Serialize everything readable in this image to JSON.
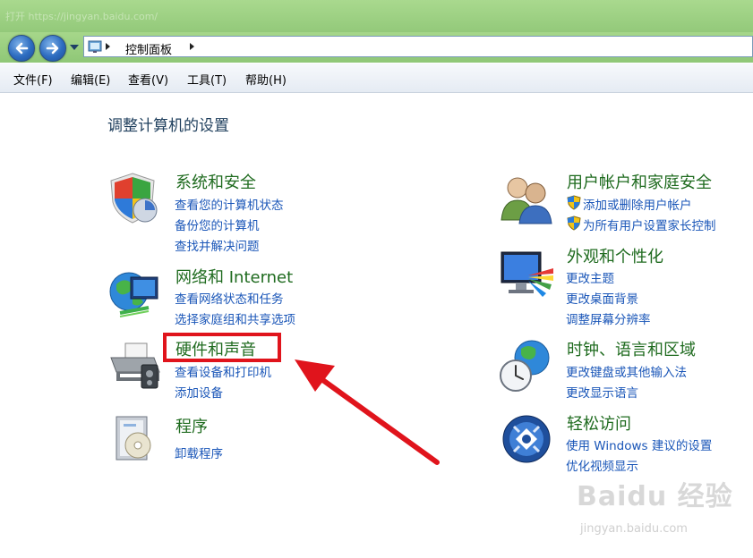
{
  "titlebar": {
    "ghost_text": "打开 https://jingyan.baidu.com/"
  },
  "nav": {
    "back_label": "后退",
    "forward_label": "前进",
    "address_crumb": "控制面板"
  },
  "menu": {
    "items": [
      "文件(F)",
      "编辑(E)",
      "查看(V)",
      "工具(T)",
      "帮助(H)"
    ]
  },
  "page": {
    "title": "调整计算机的设置"
  },
  "left_categories": [
    {
      "title": "系统和安全",
      "links": [
        "查看您的计算机状态",
        "备份您的计算机",
        "查找并解决问题"
      ]
    },
    {
      "title": "网络和 Internet",
      "links": [
        "查看网络状态和任务",
        "选择家庭组和共享选项"
      ]
    },
    {
      "title": "硬件和声音",
      "links": [
        "查看设备和打印机",
        "添加设备"
      ]
    },
    {
      "title": "程序",
      "links": [
        "卸载程序"
      ]
    }
  ],
  "right_categories": [
    {
      "title": "用户帐户和家庭安全",
      "links": [
        "添加或删除用户帐户",
        "为所有用户设置家长控制"
      ]
    },
    {
      "title": "外观和个性化",
      "links": [
        "更改主题",
        "更改桌面背景",
        "调整屏幕分辨率"
      ]
    },
    {
      "title": "时钟、语言和区域",
      "links": [
        "更改键盘或其他输入法",
        "更改显示语言"
      ]
    },
    {
      "title": "轻松访问",
      "links": [
        "使用 Windows 建议的设置",
        "优化视频显示"
      ]
    }
  ],
  "watermark": {
    "brand": "Baidu 经验",
    "url": "jingyan.baidu.com"
  },
  "colors": {
    "category_title": "#1f6b1f",
    "link": "#1a56b8",
    "highlight": "#e0141c"
  }
}
